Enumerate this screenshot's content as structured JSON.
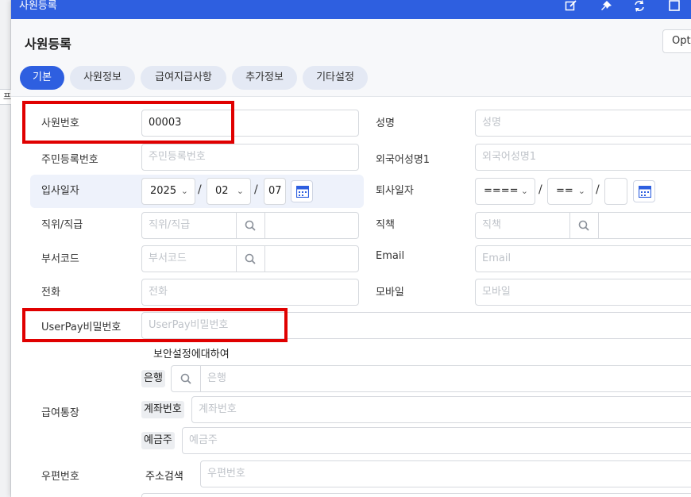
{
  "window": {
    "title": "사원등록",
    "toolbar_icons": [
      "edit-icon",
      "pin-icon",
      "refresh-icon",
      "maximize-icon"
    ]
  },
  "page": {
    "heading": "사원등록",
    "options_button": "Opt"
  },
  "background_fragment": "프",
  "tabs": [
    {
      "label": "기본",
      "active": true
    },
    {
      "label": "사원정보",
      "active": false
    },
    {
      "label": "급여지급사항",
      "active": false
    },
    {
      "label": "추가정보",
      "active": false
    },
    {
      "label": "기타설정",
      "active": false
    }
  ],
  "form": {
    "employee_no": {
      "label": "사원번호",
      "value": "00003"
    },
    "name": {
      "label": "성명",
      "placeholder": "성명"
    },
    "resident_no": {
      "label": "주민등록번호",
      "placeholder": "주민등록번호"
    },
    "foreign_name": {
      "label": "외국어성명1",
      "placeholder": "외국어성명1"
    },
    "hire_date": {
      "label": "입사일자",
      "year": "2025",
      "month": "02",
      "day": "07",
      "separator": "/"
    },
    "leave_date": {
      "label": "퇴사일자",
      "year": "====",
      "month": "==",
      "day": "",
      "separator": "/"
    },
    "position": {
      "label": "직위/직급",
      "placeholder": "직위/직급"
    },
    "duty": {
      "label": "직책",
      "placeholder": "직책"
    },
    "dept_code": {
      "label": "부서코드",
      "placeholder": "부서코드"
    },
    "email": {
      "label": "Email",
      "placeholder": "Email"
    },
    "phone": {
      "label": "전화",
      "placeholder": "전화"
    },
    "mobile": {
      "label": "모바일",
      "placeholder": "모바일"
    },
    "userpay_password": {
      "label": "UserPay비밀번호",
      "placeholder": "UserPay비밀번호"
    },
    "security_link": "보안설정에대하여",
    "salary_account": {
      "label": "급여통장",
      "bank": {
        "label": "은행",
        "placeholder": "은행"
      },
      "account_no": {
        "label": "계좌번호",
        "placeholder": "계좌번호"
      },
      "holder": {
        "label": "예금주",
        "placeholder": "예금주"
      }
    },
    "postal": {
      "label": "우편번호",
      "search_label": "주소검색",
      "placeholder": "우편번호"
    }
  },
  "colors": {
    "accent": "#2e5fe0",
    "highlight": "#e00000",
    "tab_inactive": "#e4e9f4"
  }
}
